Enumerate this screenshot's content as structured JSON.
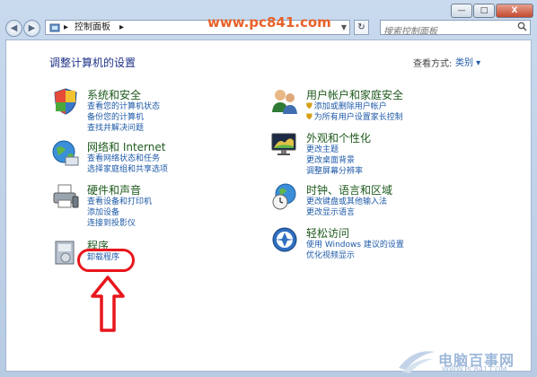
{
  "window": {
    "minimize": "—",
    "maximize": "□",
    "close": "X"
  },
  "nav": {
    "back": "◀",
    "forward": "▶",
    "address_icon": "control-panel-icon",
    "breadcrumb_sep1": "▸",
    "address_text": "控制面板",
    "breadcrumb_sep2": "▸",
    "dropdown": "▼",
    "refresh": "↻",
    "search_placeholder": "搜索控制面板"
  },
  "watermark_url": "www.pc841.com",
  "page": {
    "heading": "调整计算机的设置",
    "view_by_label": "查看方式:",
    "view_by_value": "类别 ▾"
  },
  "categories_left": [
    {
      "id": "system-security",
      "icon": "shield-icon",
      "title": "系统和安全",
      "links": [
        "查看您的计算机状态",
        "备份您的计算机",
        "查找并解决问题"
      ]
    },
    {
      "id": "network-internet",
      "icon": "globe-network-icon",
      "title": "网络和 Internet",
      "links": [
        "查看网络状态和任务",
        "选择家庭组和共享选项"
      ]
    },
    {
      "id": "hardware-sound",
      "icon": "printer-icon",
      "title": "硬件和声音",
      "links": [
        "查看设备和打印机",
        "添加设备",
        "连接到投影仪"
      ]
    },
    {
      "id": "programs",
      "icon": "programs-icon",
      "title": "程序",
      "links": [
        "卸载程序"
      ]
    }
  ],
  "categories_right": [
    {
      "id": "user-accounts",
      "icon": "users-icon",
      "title": "用户帐户和家庭安全",
      "links": [
        "添加或删除用户帐户",
        "为所有用户设置家长控制"
      ]
    },
    {
      "id": "appearance",
      "icon": "display-icon",
      "title": "外观和个性化",
      "links": [
        "更改主题",
        "更改桌面背景",
        "调整屏幕分辨率"
      ]
    },
    {
      "id": "clock-region",
      "icon": "clock-globe-icon",
      "title": "时钟、语言和区域",
      "links": [
        "更改键盘或其他输入法",
        "更改显示语言"
      ]
    },
    {
      "id": "ease-of-access",
      "icon": "ease-of-access-icon",
      "title": "轻松访问",
      "links": [
        "使用 Windows 建议的设置",
        "优化视频显示"
      ]
    }
  ],
  "footer_logo": {
    "text": "电脑百事网",
    "url": "WWW.PC841.COM"
  },
  "colors": {
    "link": "#1e5aa8",
    "category_title": "#1e5a1e",
    "annotation": "#e8161c",
    "watermark": "#e8622a"
  }
}
